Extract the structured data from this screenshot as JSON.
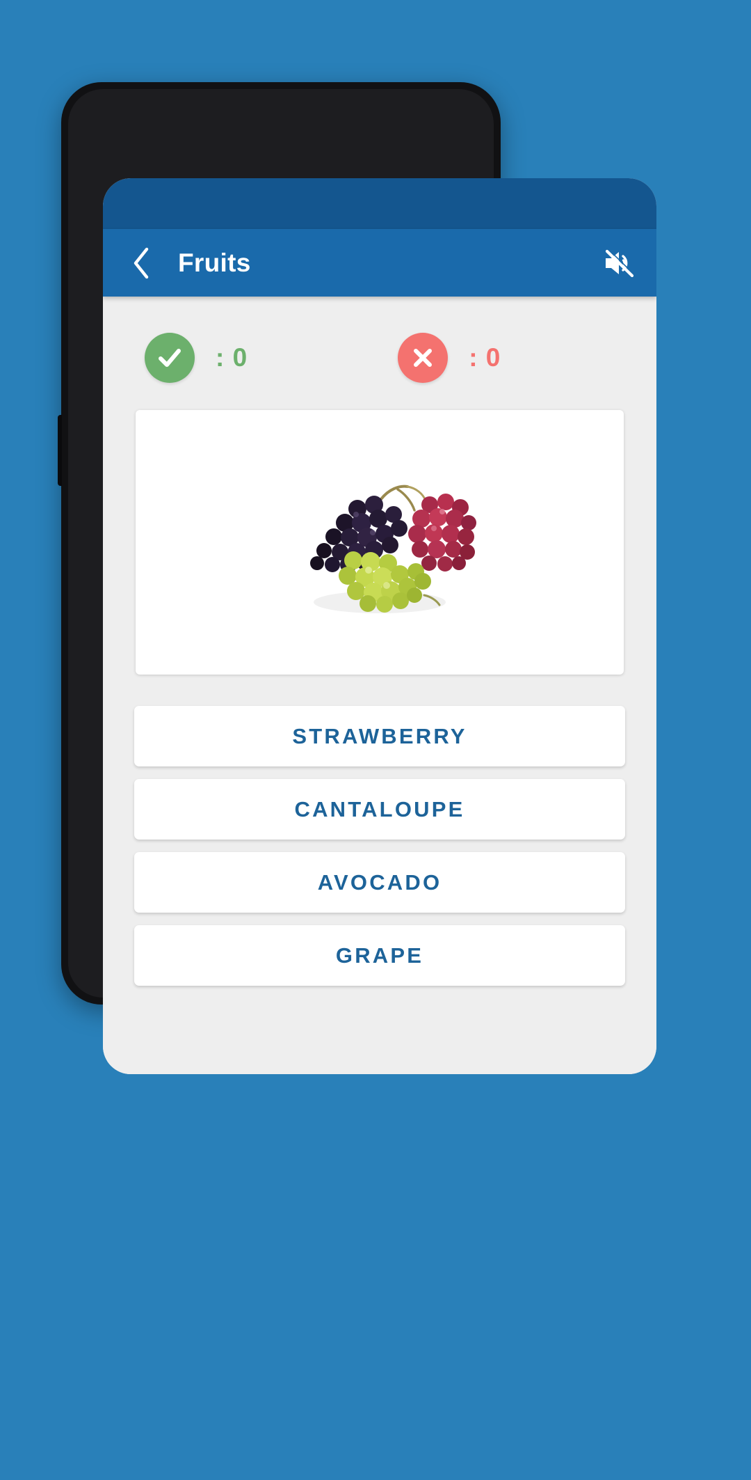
{
  "theme": {
    "page_background": "#2980b9",
    "status_bar": "#14568f",
    "app_bar": "#1a6aab",
    "content_background": "#eeeeee",
    "card_background": "#ffffff",
    "answer_text": "#1d6399",
    "correct_color": "#6cb06c",
    "wrong_color": "#f4726f",
    "nav_bar": "#ffffff",
    "nav_icon": "#8a8a8a"
  },
  "app_bar": {
    "title": "Fruits",
    "back_icon": "chevron-left-icon",
    "sound_icon": "volume-off-icon"
  },
  "score": {
    "correct": {
      "icon": "check-circle-icon",
      "label": ": 0"
    },
    "wrong": {
      "icon": "x-circle-icon",
      "label": ": 0"
    }
  },
  "question": {
    "image_alt": "grapes",
    "image_name": "grapes-photo"
  },
  "answers": [
    {
      "label": "STRAWBERRY"
    },
    {
      "label": "CANTALOUPE"
    },
    {
      "label": "AVOCADO"
    },
    {
      "label": "GRAPE"
    }
  ],
  "nav_bar": {
    "recents_icon": "menu-icon",
    "home_icon": "home-square-icon",
    "back_icon": "chevron-left-icon"
  }
}
